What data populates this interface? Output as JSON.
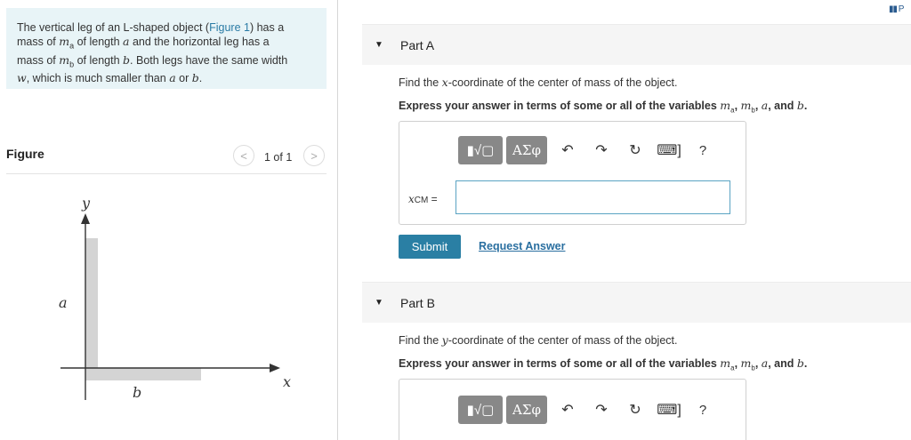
{
  "problem": {
    "line1_pre": "The vertical leg of an L-shaped object (",
    "line1_link": "Figure 1",
    "line1_post": ") has a",
    "line2_pre": "mass of ",
    "var_ma": "m",
    "sub_a": "a",
    "line2_mid": " of length ",
    "var_a": "a",
    "line2_post": " and the horizontal leg has a",
    "line3_pre": "mass of ",
    "var_mb": "m",
    "sub_b": "b",
    "line3_mid": " of length ",
    "var_b": "b",
    "line3_post": ". Both legs have the same width",
    "var_w": "w",
    "line4_mid": ", which is much smaller than ",
    "var_a2": "a",
    "line4_or": " or ",
    "var_b2": "b",
    "line4_end": "."
  },
  "figure": {
    "title": "Figure",
    "counter": "1 of 1",
    "prev": "<",
    "next": ">",
    "axis_y": "y",
    "axis_x": "x",
    "label_a": "a",
    "label_b": "b"
  },
  "partA": {
    "label": "Part A",
    "question_pre": "Find the ",
    "question_var": "x",
    "question_post": "-coordinate of the center of mass of the object.",
    "instruction_pre": "Express your answer in terms of some or all of the variables ",
    "instruction_vars": "m",
    "instruction_end": "a, m",
    "instruction_tail": "b, a, and b.",
    "input_label": "xCM =",
    "submit": "Submit",
    "request": "Request Answer"
  },
  "partB": {
    "label": "Part B",
    "question_pre": "Find the ",
    "question_var": "y",
    "question_post": "-coordinate of the center of mass of the object."
  },
  "toolbar": {
    "template_label": "▮√▢",
    "greek_label": "ΑΣφ",
    "undo": "↶",
    "redo": "↷",
    "reset": "↻",
    "keyboard": "⌨]",
    "help": "?"
  },
  "top_mark": "▮▮ P",
  "colors": {
    "problem_bg": "#e8f4f7",
    "submit": "#2a7fa4",
    "link": "#2a7ba5",
    "figure_gray": "#d4d4d4"
  }
}
